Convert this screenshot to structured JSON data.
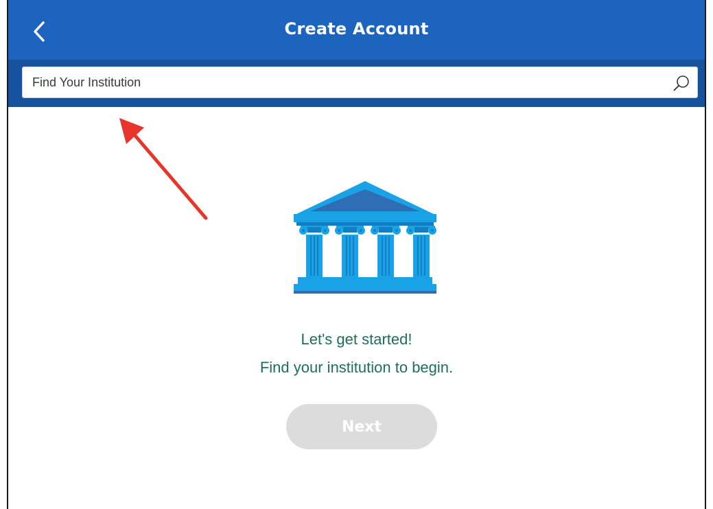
{
  "header": {
    "title": "Create Account",
    "back_icon": "chevron-left-icon",
    "background_color": "#1d64be"
  },
  "search": {
    "placeholder": "Find Your Institution",
    "value": "",
    "icon": "search-icon",
    "bar_color": "#17529f"
  },
  "main": {
    "illustration_icon": "bank-building-icon",
    "welcome_line_1": "Let's get started!",
    "welcome_line_2": "Find your institution to begin.",
    "text_color": "#1d6e5a",
    "next_button_label": "Next",
    "next_button_state": "disabled",
    "next_button_color": "#dcdcdc"
  },
  "annotation": {
    "arrow_icon": "red-arrow-icon",
    "arrow_color": "#e8352b"
  }
}
